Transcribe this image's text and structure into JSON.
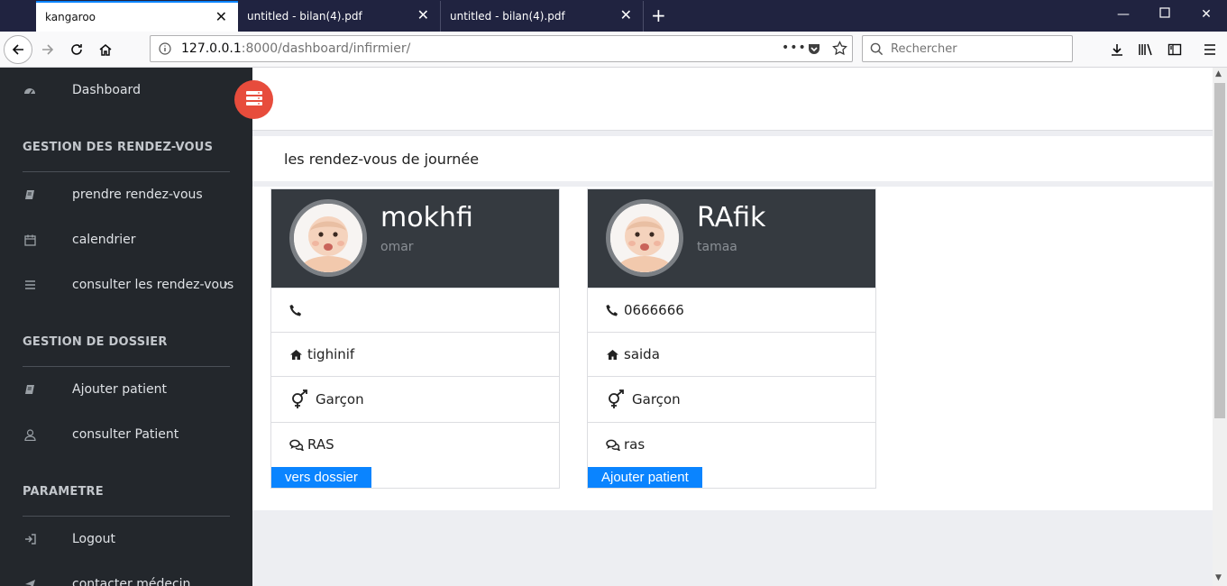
{
  "browser": {
    "tabs": [
      {
        "label": "kangaroo"
      },
      {
        "label": "untitled - bilan(4).pdf"
      },
      {
        "label": "untitled - bilan(4).pdf"
      }
    ],
    "url_host": "127.0.0.1",
    "url_rest": ":8000/dashboard/infirmier/",
    "search_placeholder": "Rechercher"
  },
  "sidebar": {
    "dashboard": "Dashboard",
    "section1": "GESTION DES RENDEZ-VOUS",
    "items1": [
      "prendre rendez-vous",
      "calendrier",
      "consulter les rendez-vous"
    ],
    "section2": "GESTION DE DOSSIER",
    "items2": [
      "Ajouter patient",
      "consulter Patient"
    ],
    "section3": "PARAMETRE",
    "items3": [
      "Logout",
      "contacter médecin"
    ]
  },
  "main": {
    "panel_title": "les rendez-vous de journée",
    "cards": [
      {
        "name": "mokhfi",
        "sub": "omar",
        "phone": "",
        "address": "tighinif",
        "gender": "Garçon",
        "comment": "RAS",
        "button": "vers dossier"
      },
      {
        "name": "RAfik",
        "sub": "tamaa",
        "phone": "0666666",
        "address": "saida",
        "gender": "Garçon",
        "comment": "ras",
        "button": "Ajouter patient"
      }
    ]
  },
  "colors": {
    "accent": "#0a84ff",
    "toggle": "#e74c3c",
    "sidebar": "#23272c",
    "card_header": "#353a40"
  }
}
